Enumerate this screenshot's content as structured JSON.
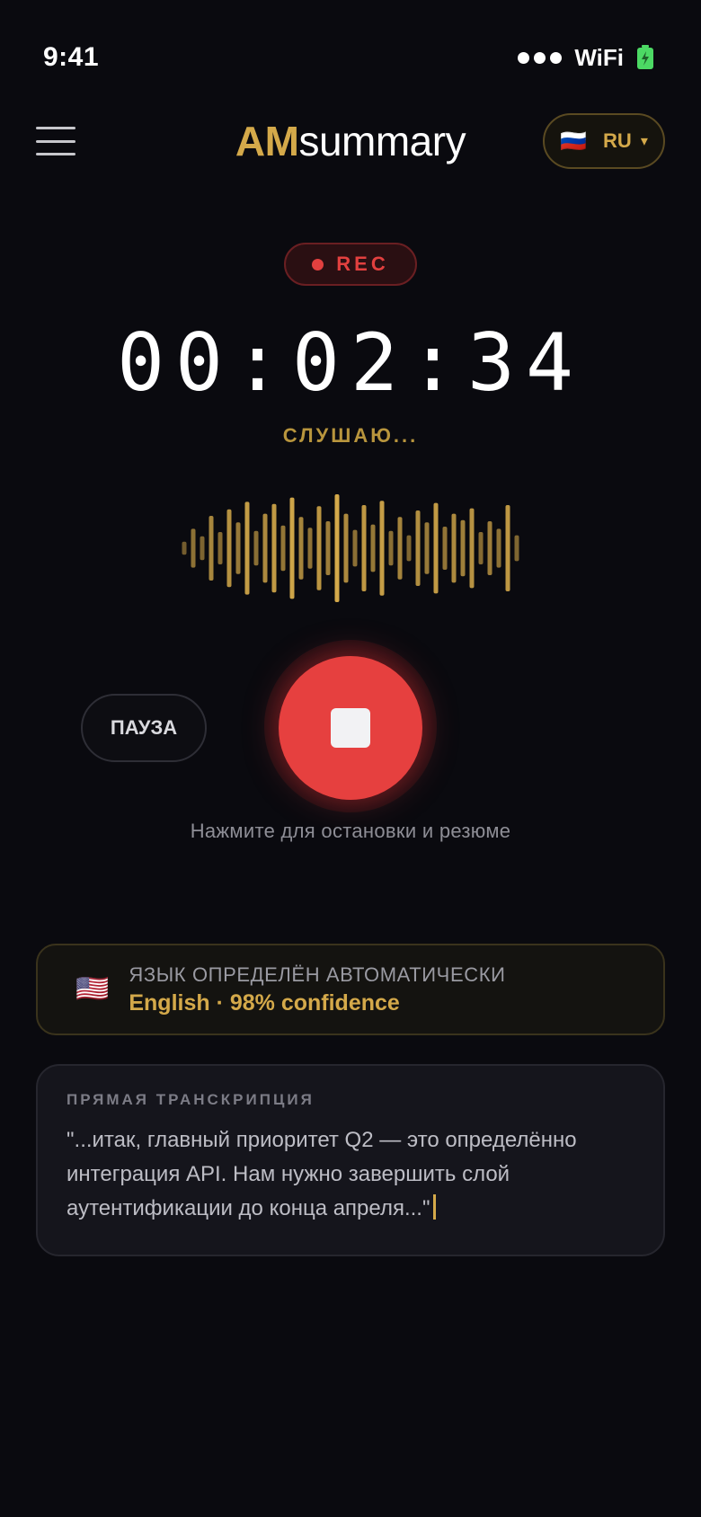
{
  "status_bar": {
    "time": "9:41",
    "wifi": "WiFi",
    "icons": [
      "signal-icon",
      "wifi-icon",
      "battery-icon"
    ]
  },
  "header": {
    "logo_am": "AM",
    "logo_rest": "summary",
    "lang_flag": "🇷🇺",
    "lang_code": "RU",
    "menu_icon": "hamburger-menu-icon",
    "lang_chevron": "▾"
  },
  "recording": {
    "badge": "REC",
    "timer": "00:02:34",
    "status": "СЛУШАЮ...",
    "pause_label": "ПАУЗА",
    "hint": "Нажмите для остановки и резюме",
    "waveform_levels": [
      0.12,
      0.36,
      0.22,
      0.6,
      0.3,
      0.72,
      0.48,
      0.86,
      0.32,
      0.64,
      0.82,
      0.42,
      0.94,
      0.58,
      0.38,
      0.78,
      0.5,
      1.0,
      0.64,
      0.34,
      0.8,
      0.44,
      0.88,
      0.32,
      0.58,
      0.24,
      0.7,
      0.48,
      0.84,
      0.4,
      0.64,
      0.52,
      0.74,
      0.3,
      0.5,
      0.36,
      0.8,
      0.24
    ]
  },
  "colors": {
    "accent_gold": "#d4a94a",
    "record_red": "#e6403f",
    "background": "#0a0a0f"
  },
  "language_detect": {
    "flag": "🇺🇸",
    "label": "ЯЗЫК ОПРЕДЕЛЁН АВТОМАТИЧЕСКИ",
    "value": "English · 98% confidence"
  },
  "transcript": {
    "title": "ПРЯМАЯ ТРАНСКРИПЦИЯ",
    "text": "\"...итак, главный приоритет Q2 — это определённо интеграция API. Нам нужно завершить слой аутентификации до конца апреля...\""
  }
}
